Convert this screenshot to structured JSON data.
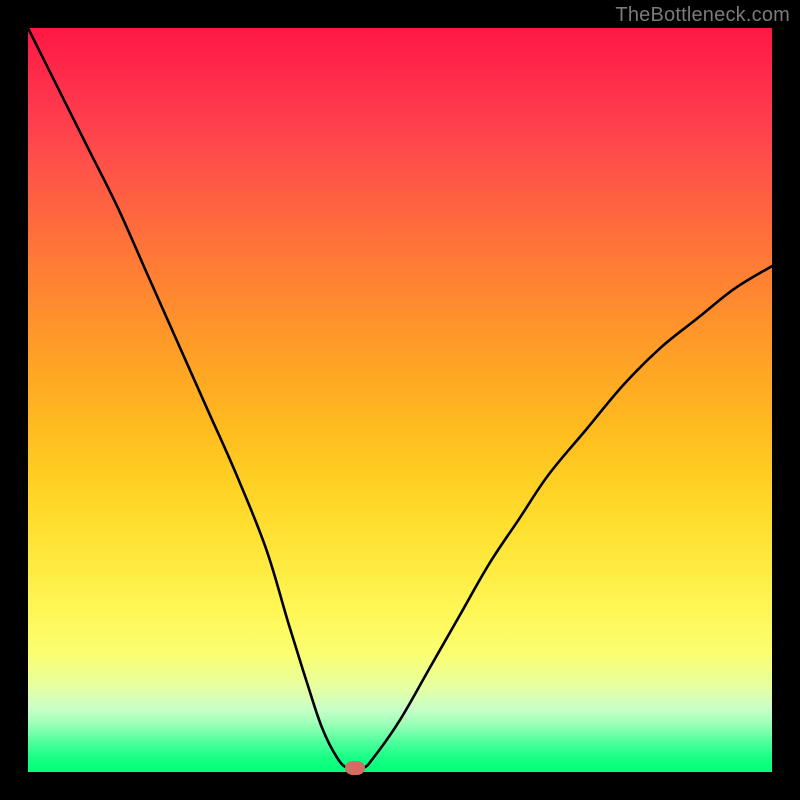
{
  "watermark": "TheBottleneck.com",
  "colors": {
    "frame": "#000000",
    "curve": "#000000",
    "marker": "#cf6e62",
    "gradient_top": "#ff1744",
    "gradient_mid": "#ffdd2d",
    "gradient_bottom": "#00ff78"
  },
  "chart_data": {
    "type": "line",
    "title": "",
    "xlabel": "",
    "ylabel": "",
    "xlim": [
      0,
      100
    ],
    "ylim": [
      0,
      100
    ],
    "grid": false,
    "legend": false,
    "series": [
      {
        "name": "bottleneck-curve",
        "x": [
          0,
          4,
          8,
          12,
          16,
          20,
          24,
          28,
          32,
          35,
          37.5,
          39.5,
          41.5,
          43,
          45,
          46.5,
          50,
          54,
          58,
          62,
          66,
          70,
          75,
          80,
          85,
          90,
          95,
          100
        ],
        "values": [
          100,
          92,
          84,
          76,
          67,
          58,
          49,
          40,
          30,
          20,
          12,
          6,
          2,
          0.5,
          0.5,
          2,
          7,
          14,
          21,
          28,
          34,
          40,
          46,
          52,
          57,
          61,
          65,
          68
        ]
      }
    ],
    "annotations": [
      {
        "name": "optimal-marker",
        "x": 44,
        "y": 0.5
      }
    ]
  }
}
